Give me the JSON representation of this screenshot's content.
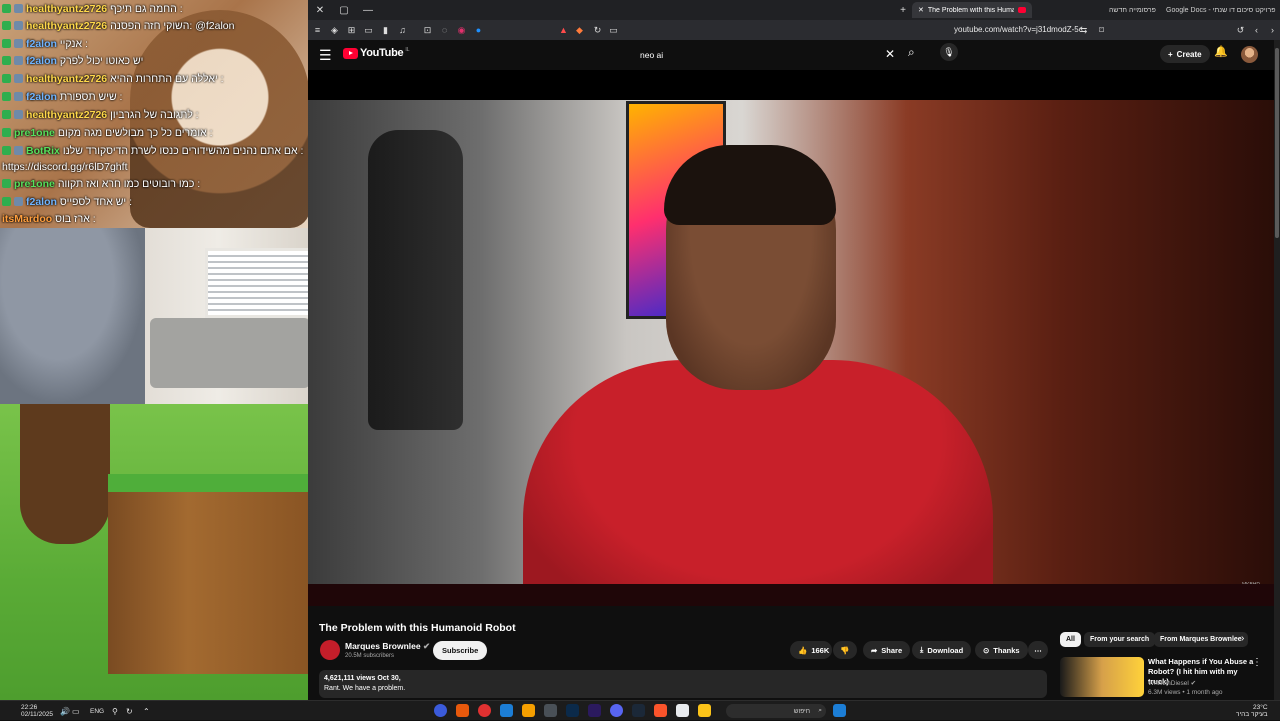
{
  "chat": {
    "messages": [
      {
        "user": "healthyantz2726",
        "color": "u-yellow",
        "text": "החמה גם תיכף :"
      },
      {
        "user": "healthyantz2726",
        "color": "u-yellow",
        "text": "השוקי חזה הפסנה: @f2alon"
      },
      {
        "user": "f2alon",
        "color": "u-blue",
        "text": "אנקיי :"
      },
      {
        "user": "f2alon",
        "color": "u-blue",
        "text": "יש כאוטו יכול לפרק"
      },
      {
        "user": "healthyantz2726",
        "color": "u-yellow",
        "text": "יאללה עם התחרות ההיא :"
      },
      {
        "user": "f2alon",
        "color": "u-blue",
        "text": "שיש תספורת :"
      },
      {
        "user": "healthyantz2726",
        "color": "u-yellow",
        "text": "לתגובה של הגרביון :"
      },
      {
        "user": "pre1one",
        "color": "u-green",
        "text": "אומרים כל כך מבולשים מגה מקום :"
      },
      {
        "user": "BotRix",
        "color": "u-green",
        "text": "אם אתם נהנים מהשידורים כנסו לשרת הדיסקורד שלנו :"
      },
      {
        "user": "",
        "color": "u-green",
        "text": "https://discord.gg/r6lD7ghft"
      },
      {
        "user": "pre1one",
        "color": "u-green",
        "text": "כמו רובוטים כמו חרא ואז תקווה :"
      },
      {
        "user": "f2alon",
        "color": "u-blue",
        "text": "יש אחד לספייס :"
      },
      {
        "user": "itsMardoo",
        "color": "u-orange",
        "text": "ארז בוס :"
      }
    ]
  },
  "browser": {
    "tabs": [
      {
        "label": "The Problem with this Humanoid Robot",
        "active": true
      },
      {
        "label": "פרסומייה חדשה",
        "active": false
      },
      {
        "label": "Google Docs - פרויקט סיכום דו שנתי",
        "active": false
      }
    ],
    "url": "youtube.com/watch?v=j31dmodZ-5c"
  },
  "yt": {
    "logo": "YouTube",
    "logo_country": "IL",
    "search_value": "neo ai",
    "search_placeholder": "Search",
    "create_label": "Create"
  },
  "video": {
    "watermark": "MKBHD",
    "title": "The Problem with this Humanoid Robot",
    "channel": "Marques Brownlee",
    "subscribers": "20.5M subscribers",
    "subscribe_label": "Subscribe",
    "likes": "166K",
    "share_label": "Share",
    "download_label": "Download",
    "thanks_label": "Thanks",
    "views": "4,621,111 views",
    "date": "Oct 30,",
    "desc_line": "Rant. We have a problem."
  },
  "sidebar": {
    "chips": [
      "All",
      "From your search",
      "From Marques Brownlee"
    ],
    "rec": {
      "title": "What Happens if You Abuse a Robot? (I hit him with my truck)",
      "channel": "WhistlinDiesel",
      "meta": "6.3M views • 1 month ago"
    }
  },
  "taskbar": {
    "time": "22:26",
    "date": "02/11/2025",
    "lang": "ENG",
    "search_label": "חיפוש",
    "weather_temp": "23°C",
    "weather_text": "בעיקר בהיר"
  }
}
